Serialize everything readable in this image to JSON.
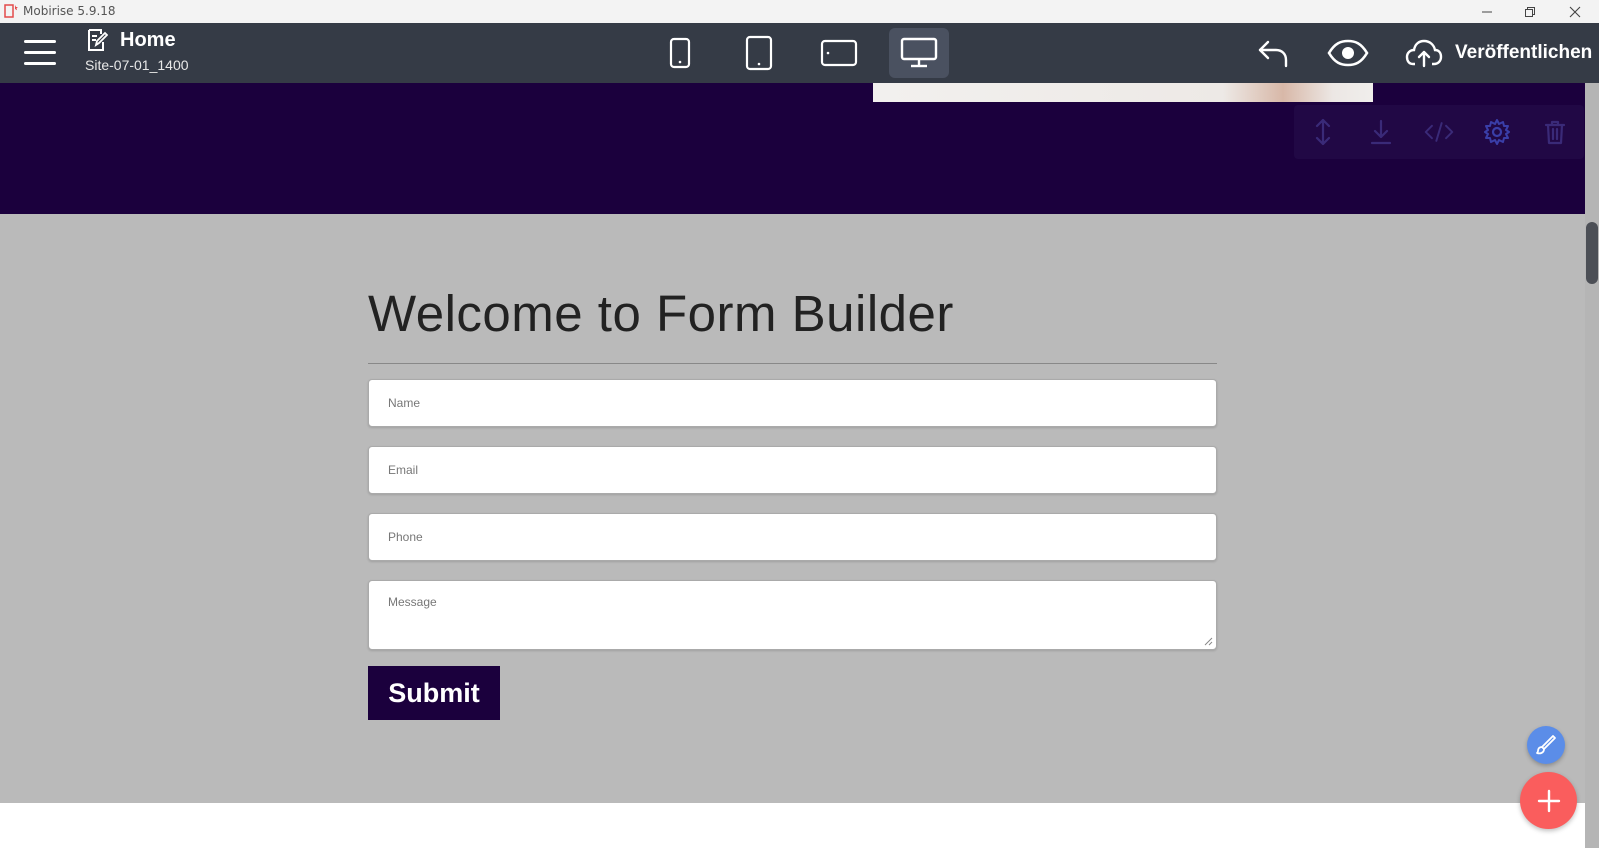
{
  "window": {
    "title": "Mobirise 5.9.18",
    "controls": [
      "minimize-icon",
      "restore-icon",
      "close-icon"
    ]
  },
  "toolbar": {
    "menu_icon": "hamburger-menu-icon",
    "page_icon": "edit-page-icon",
    "page_name": "Home",
    "site_name": "Site-07-01_1400",
    "devices": [
      {
        "icon": "phone-icon",
        "active": false
      },
      {
        "icon": "tablet-icon",
        "active": false
      },
      {
        "icon": "tablet-landscape-icon",
        "active": false
      },
      {
        "icon": "desktop-icon",
        "active": true
      }
    ],
    "undo_icon": "undo-icon",
    "preview_icon": "eye-icon",
    "publish_icon": "cloud-upload-icon",
    "publish_label": "Veröffentlichen"
  },
  "block_tools": [
    "move-icon",
    "download-icon",
    "code-icon",
    "gear-icon",
    "trash-icon"
  ],
  "form": {
    "title": "Welcome to Form Builder",
    "fields": {
      "name_placeholder": "Name",
      "email_placeholder": "Email",
      "phone_placeholder": "Phone",
      "message_placeholder": "Message"
    },
    "submit_label": "Submit"
  },
  "colors": {
    "toolbar_bg": "#353b46",
    "dark_section": "#1b003d",
    "form_section": "#bababa",
    "fab_edit": "#5b8de8",
    "fab_add": "#fa5d5d"
  }
}
